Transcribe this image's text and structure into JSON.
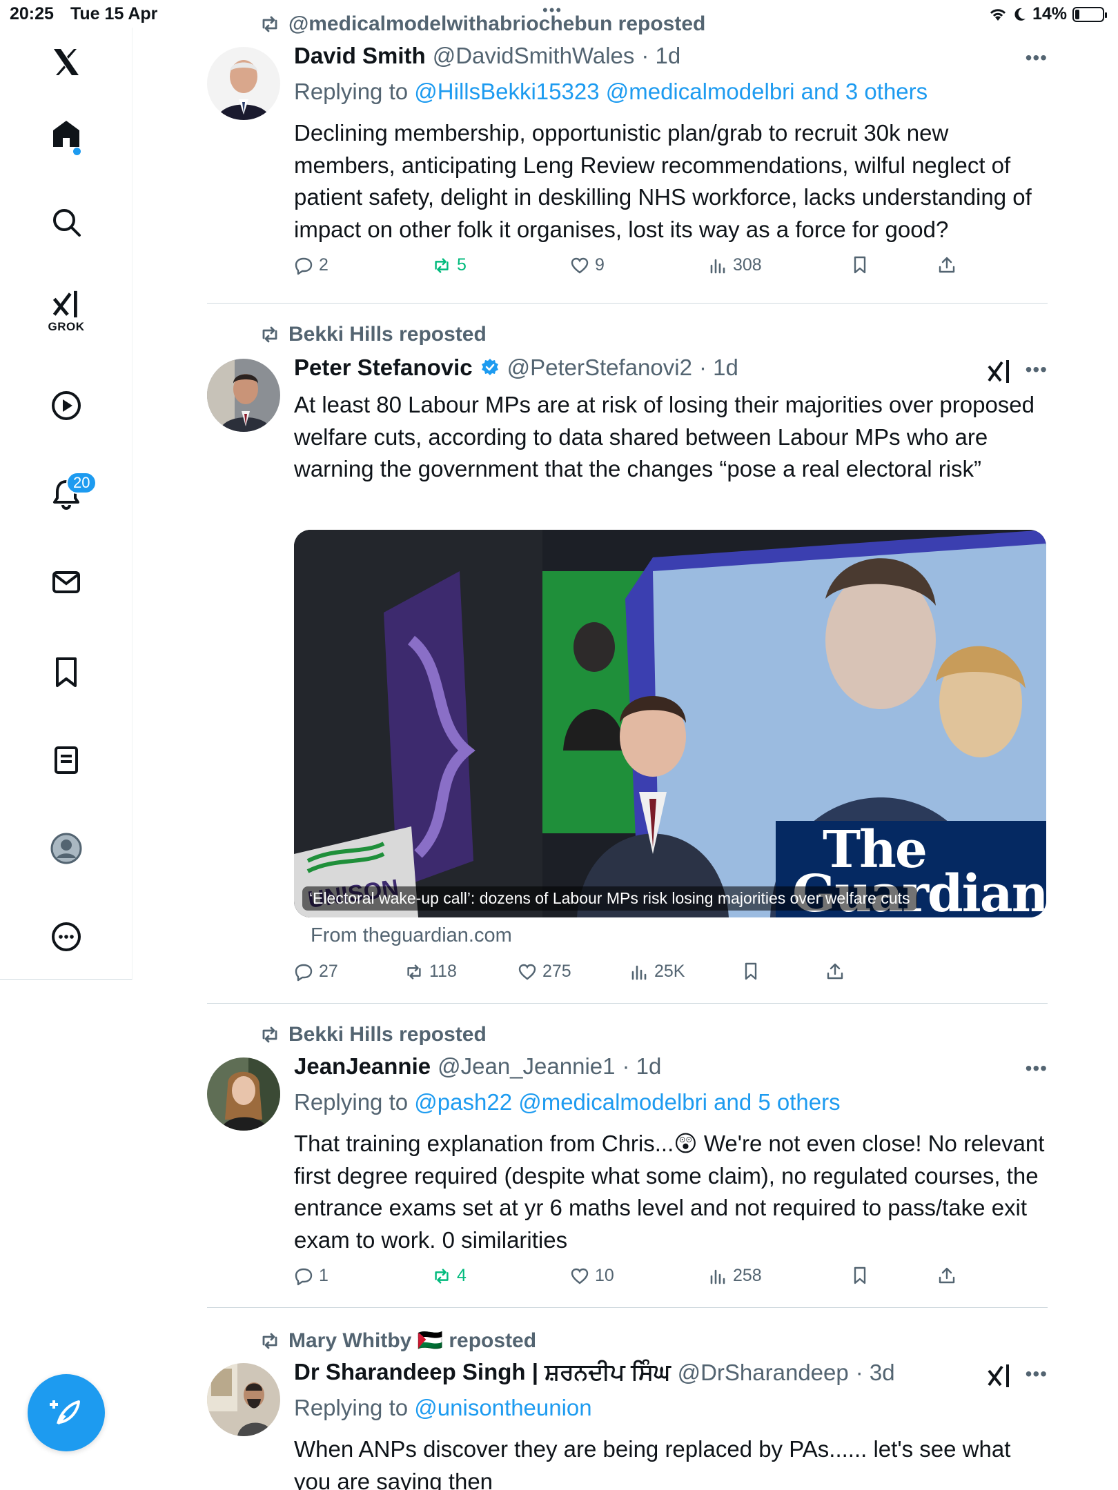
{
  "status_bar": {
    "time": "20:25",
    "date": "Tue 15 Apr",
    "battery": "14%"
  },
  "sidebar": {
    "items": [
      {
        "name": "x-logo-icon"
      },
      {
        "name": "home-icon"
      },
      {
        "name": "search-icon"
      },
      {
        "name": "grok-icon",
        "label": "GROK"
      },
      {
        "name": "video-icon"
      },
      {
        "name": "notifications-icon",
        "badge": "20"
      },
      {
        "name": "messages-icon"
      },
      {
        "name": "bookmarks-icon"
      },
      {
        "name": "lists-icon"
      },
      {
        "name": "profile-icon"
      },
      {
        "name": "more-icon"
      }
    ],
    "compose_icon": "compose-icon"
  },
  "posts": [
    {
      "repost_by": "@medicalmodelwithabriochebun reposted",
      "name": "David Smith",
      "handle": "@DavidSmithWales",
      "time": "· 1d",
      "replying_prefix": "Replying to",
      "replying_links": "@HillsBekki15323 @medicalmodelbri and 3 others",
      "text": "Declining membership, opportunistic plan/grab to recruit 30k new members, anticipating Leng Review recommendations, wilful neglect of patient safety, delight in deskilling NHS workforce, lacks understanding of impact on other folk it organises, lost its way as a force for good?",
      "replies": "2",
      "reposts": "5",
      "likes": "9",
      "views": "308"
    },
    {
      "repost_by": "Bekki Hills reposted",
      "name": "Peter Stefanovic",
      "handle": "@PeterStefanovi2",
      "time": "· 1d",
      "text": "At least 80 Labour MPs are at risk of losing their majorities over proposed welfare cuts, according to data shared between Labour MPs who are warning the government that the changes “pose a real electoral risk”",
      "card_caption": "‘Electoral wake-up call’: dozens of Labour MPs risk losing majorities over welfare cuts",
      "card_logo_line1": "The",
      "card_logo_line2": "Guardian",
      "card_sign": "UNISON",
      "card_source": "From theguardian.com",
      "replies": "27",
      "reposts": "118",
      "likes": "275",
      "views": "25K"
    },
    {
      "repost_by": "Bekki Hills reposted",
      "name": "JeanJeannie",
      "handle": "@Jean_Jeannie1",
      "time": "· 1d",
      "replying_prefix": "Replying to",
      "replying_links": "@pash22 @medicalmodelbri and 5 others",
      "text": "That training explanation from Chris...😲 We're not even close! No relevant first degree required (despite what some claim), no regulated courses, the entrance exams set at yr 6 maths level and not required to pass/take exit exam to work. 0 similarities",
      "replies": "1",
      "reposts": "4",
      "likes": "10",
      "views": "258"
    },
    {
      "repost_by": "Mary Whitby 🇵🇸 reposted",
      "name": "Dr Sharandeep Singh | ਸ਼ਰਨਦੀਪ ਸਿੰਘ",
      "handle": "@DrSharandeep",
      "time": "· 3d",
      "replying_prefix": "Replying to",
      "replying_links": "@unisontheunion",
      "text": "When ANPs discover they are being replaced by PAs...... let's see what you are saying then"
    }
  ],
  "colors": {
    "accent": "#1d9bf0",
    "repost_green": "#00ba7c",
    "muted": "#536471",
    "guardian_blue": "#052962"
  }
}
